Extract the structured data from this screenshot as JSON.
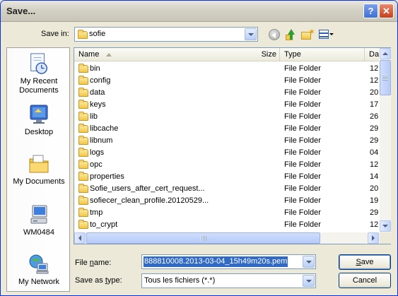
{
  "window": {
    "title": "Save..."
  },
  "toolbar": {
    "save_in_label": "Save in:",
    "save_in_value": "sofie"
  },
  "places": [
    {
      "label_line1": "My Recent",
      "label_line2": "Documents",
      "icon": "recent-documents-icon"
    },
    {
      "label_line1": "Desktop",
      "label_line2": "",
      "icon": "desktop-icon"
    },
    {
      "label_line1": "My Documents",
      "label_line2": "",
      "icon": "my-documents-icon"
    },
    {
      "label_line1": "WM0484",
      "label_line2": "",
      "icon": "computer-icon"
    },
    {
      "label_line1": "My Network",
      "label_line2": "",
      "icon": "network-icon"
    }
  ],
  "filelist": {
    "columns": {
      "name": "Name",
      "size": "Size",
      "type": "Type",
      "date": "Da"
    },
    "rows": [
      {
        "name": "bin",
        "type": "File Folder",
        "date": "12"
      },
      {
        "name": "config",
        "type": "File Folder",
        "date": "12"
      },
      {
        "name": "data",
        "type": "File Folder",
        "date": "20"
      },
      {
        "name": "keys",
        "type": "File Folder",
        "date": "17"
      },
      {
        "name": "lib",
        "type": "File Folder",
        "date": "26"
      },
      {
        "name": "libcache",
        "type": "File Folder",
        "date": "29"
      },
      {
        "name": "libnum",
        "type": "File Folder",
        "date": "29"
      },
      {
        "name": "logs",
        "type": "File Folder",
        "date": "04"
      },
      {
        "name": "opc",
        "type": "File Folder",
        "date": "12"
      },
      {
        "name": "properties",
        "type": "File Folder",
        "date": "14"
      },
      {
        "name": "Sofie_users_after_cert_request...",
        "type": "File Folder",
        "date": "20"
      },
      {
        "name": "sofiecer_clean_profile.20120529...",
        "type": "File Folder",
        "date": "19"
      },
      {
        "name": "tmp",
        "type": "File Folder",
        "date": "29"
      },
      {
        "name": "to_crypt",
        "type": "File Folder",
        "date": "12"
      }
    ]
  },
  "footer": {
    "file_name_label_pre": "File ",
    "file_name_label_u": "n",
    "file_name_label_post": "ame:",
    "file_name_value": "888810008.2013-03-04_15h49m20s.pem",
    "save_type_label_pre": "Save as ",
    "save_type_label_u": "t",
    "save_type_label_post": "ype:",
    "save_type_value": "Tous les fichiers (*.*)",
    "save_button_u": "S",
    "save_button_rest": "ave",
    "cancel_button": "Cancel"
  },
  "colors": {
    "selection": "#316ac5",
    "dialog_bg": "#ece9d8",
    "border_blue": "#7f9db9"
  }
}
